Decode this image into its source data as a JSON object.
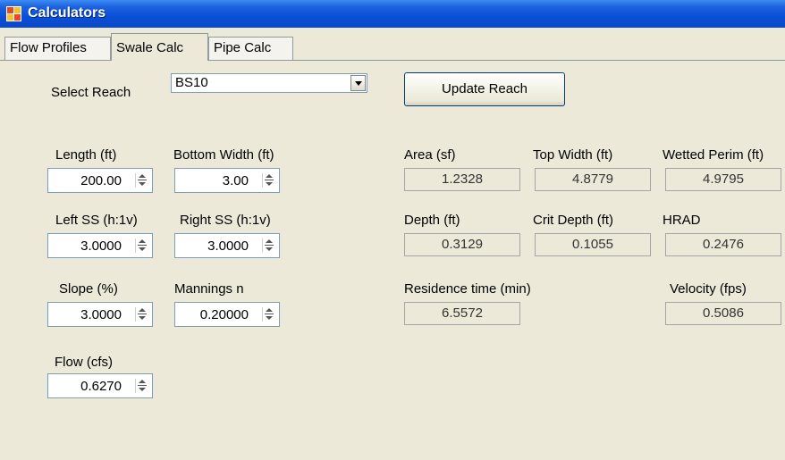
{
  "window": {
    "title": "Calculators"
  },
  "tabs": [
    {
      "label": "Flow Profiles",
      "active": false
    },
    {
      "label": "Swale Calc",
      "active": true
    },
    {
      "label": "Pipe Calc",
      "active": false
    }
  ],
  "reach": {
    "label": "Select Reach",
    "value": "BS10",
    "update_button": "Update Reach"
  },
  "inputs": {
    "length": {
      "label": "Length (ft)",
      "value": "200.00"
    },
    "bottom_width": {
      "label": "Bottom Width (ft)",
      "value": "3.00"
    },
    "left_ss": {
      "label": "Left SS (h:1v)",
      "value": "3.0000"
    },
    "right_ss": {
      "label": "Right SS (h:1v)",
      "value": "3.0000"
    },
    "slope": {
      "label": "Slope (%)",
      "value": "3.0000"
    },
    "mannings": {
      "label": "Mannings n",
      "value": "0.20000"
    },
    "flow": {
      "label": "Flow (cfs)",
      "value": "0.6270"
    }
  },
  "outputs": {
    "area": {
      "label": "Area (sf)",
      "value": "1.2328"
    },
    "top_width": {
      "label": "Top Width (ft)",
      "value": "4.8779"
    },
    "wetted_perim": {
      "label": "Wetted Perim (ft)",
      "value": "4.9795"
    },
    "depth": {
      "label": "Depth (ft)",
      "value": "0.3129"
    },
    "crit_depth": {
      "label": "Crit Depth (ft)",
      "value": "0.1055"
    },
    "hrad": {
      "label": "HRAD",
      "value": "0.2476"
    },
    "residence_time": {
      "label": "Residence time (min)",
      "value": "6.5572"
    },
    "velocity": {
      "label": "Velocity (fps)",
      "value": "0.5086"
    }
  },
  "colors": {
    "titlebar": "#0a4fd6",
    "window_bg": "#ece9d8",
    "input_border": "#7f9db9"
  }
}
